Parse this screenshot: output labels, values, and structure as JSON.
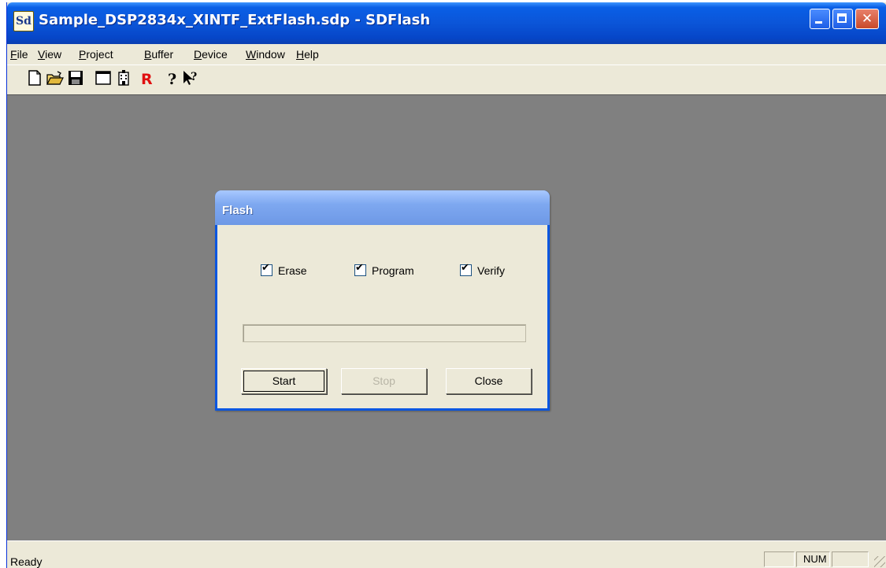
{
  "window": {
    "title": "Sample_DSP2834x_XINTF_ExtFlash.sdp - SDFlash",
    "app_icon_text": "Sd"
  },
  "menu": [
    {
      "label": "File"
    },
    {
      "label": "View"
    },
    {
      "label": "Project"
    },
    {
      "label": "Buffer"
    },
    {
      "label": "Device"
    },
    {
      "label": "Window"
    },
    {
      "label": "Help"
    }
  ],
  "toolbar": {
    "icons": [
      "new-file-icon",
      "open-folder-icon",
      "save-icon",
      "window-icon",
      "building-icon",
      "reset-r-icon",
      "help-icon",
      "context-help-icon"
    ]
  },
  "dialog": {
    "title": "Flash",
    "options": [
      {
        "label": "Erase",
        "checked": true
      },
      {
        "label": "Program",
        "checked": true
      },
      {
        "label": "Verify",
        "checked": true
      }
    ],
    "progress": 0,
    "buttons": {
      "start": "Start",
      "stop": "Stop",
      "close": "Close"
    }
  },
  "status": {
    "text": "Ready",
    "num": "NUM"
  },
  "colors": {
    "titlebar": "#0a5fe6",
    "client": "#808080",
    "face": "#ece9d8"
  }
}
